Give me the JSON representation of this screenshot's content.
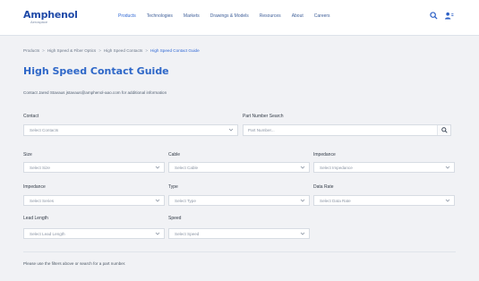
{
  "header": {
    "brand": "Amphenol",
    "brand_sub": "Aerospace",
    "nav": [
      "Products",
      "Technologies",
      "Markets",
      "Drawings & Models",
      "Resources",
      "About",
      "Careers"
    ],
    "active_nav": "Products"
  },
  "breadcrumb": [
    "Products",
    "High Speed & Fiber Optics",
    "High Speed Contacts",
    "High Speed Contact Guide"
  ],
  "page_title": "High Speed Contact Guide",
  "contact_text": "Contact Jared Stavaus jstavaus@amphenol-aao.com for additional information",
  "filters": {
    "contact": {
      "label": "Contact",
      "value": "Select Contacts"
    },
    "part_search": {
      "label": "Part Number Search",
      "placeholder": "Part Number..."
    },
    "size": {
      "label": "Size",
      "value": "Select Size"
    },
    "cable": {
      "label": "Cable",
      "value": "Select Cable"
    },
    "impedance_top": {
      "label": "Impedance",
      "value": "Select Impedance"
    },
    "impedance_left": {
      "label": "Impedance",
      "value": "Select Series"
    },
    "type": {
      "label": "Type",
      "value": "Select Type"
    },
    "data_rate": {
      "label": "Data Rate",
      "value": "Select Data Rate"
    },
    "lead_length": {
      "label": "Lead Length",
      "value": "Select Lead Length"
    },
    "speed": {
      "label": "Speed",
      "value": "Select Speed"
    }
  },
  "help_text": "Please use the filters above or search for a part number."
}
